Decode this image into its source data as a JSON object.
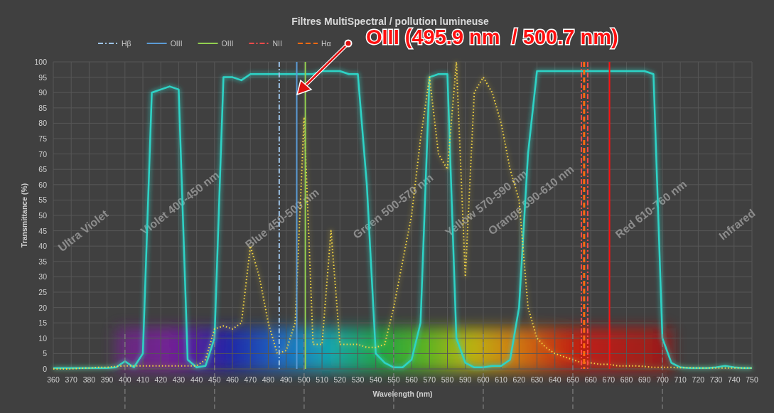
{
  "chart": {
    "chart_data": {
      "type": "line",
      "title": "Filtres MultiSpectral / pollution lumineuse",
      "xlabel": "Wavelength (nm)",
      "ylabel": "Transmittance (%)",
      "x": [
        360,
        365,
        370,
        375,
        380,
        385,
        390,
        395,
        400,
        405,
        410,
        415,
        420,
        425,
        430,
        435,
        440,
        445,
        450,
        455,
        460,
        465,
        470,
        475,
        480,
        485,
        490,
        495,
        500,
        505,
        510,
        515,
        520,
        525,
        530,
        535,
        540,
        545,
        550,
        555,
        560,
        565,
        570,
        575,
        580,
        585,
        590,
        595,
        600,
        605,
        610,
        615,
        620,
        625,
        630,
        635,
        640,
        645,
        650,
        655,
        660,
        665,
        670,
        675,
        680,
        685,
        690,
        695,
        700,
        705,
        710,
        715,
        720,
        725,
        730,
        735,
        740,
        745,
        750
      ],
      "series": [
        {
          "color": "#2ed3c6",
          "line_style": "solid",
          "values": [
            0.3,
            0.3,
            0.3,
            0.3,
            0.3,
            0.3,
            0.3,
            0.5,
            2.5,
            0.5,
            5,
            90,
            91,
            92,
            91,
            3,
            0.5,
            1,
            10,
            95,
            95,
            94,
            96,
            96,
            96,
            96,
            96,
            96,
            96,
            96,
            97,
            97,
            97,
            96,
            96,
            60,
            5,
            2,
            0.5,
            0.5,
            3,
            15,
            95,
            96,
            96,
            10,
            2,
            0.5,
            0.5,
            1,
            1,
            3,
            20,
            70,
            97,
            97,
            97,
            97,
            97,
            97,
            97,
            97,
            97,
            97,
            97,
            97,
            97,
            96,
            10,
            2,
            0.5,
            0.3,
            0.3,
            0.3,
            0.5,
            1,
            0.5,
            0.3,
            0.3
          ]
        },
        {
          "color": "#f5d742",
          "line_style": "dotted",
          "values": [
            0,
            0,
            0,
            0.2,
            0.3,
            0.5,
            0.5,
            0.8,
            1,
            1,
            1,
            1,
            1,
            1,
            1,
            1,
            1,
            3,
            13,
            14,
            13,
            15,
            40,
            30,
            15,
            5,
            6,
            15,
            82,
            8,
            8,
            45,
            8,
            8,
            8,
            7,
            7,
            8,
            20,
            35,
            50,
            75,
            95,
            70,
            65,
            100,
            30,
            90,
            95,
            90,
            80,
            65,
            55,
            20,
            10,
            7,
            5,
            4,
            3,
            2,
            2,
            1.5,
            1.5,
            1,
            1,
            1,
            0.8,
            0.5,
            0.5,
            0.5,
            0.4,
            0.4,
            0.3,
            0.3,
            0.3,
            0.3,
            0.3,
            0.3,
            0.3
          ]
        }
      ],
      "xlim": [
        360,
        750
      ],
      "ylim": [
        0,
        100
      ],
      "xticks": [
        360,
        370,
        380,
        390,
        400,
        410,
        420,
        430,
        440,
        450,
        460,
        470,
        480,
        490,
        500,
        510,
        520,
        530,
        540,
        550,
        560,
        570,
        580,
        590,
        600,
        610,
        620,
        630,
        640,
        650,
        660,
        670,
        680,
        690,
        700,
        710,
        720,
        730,
        740,
        750
      ],
      "yticks": [
        0,
        5,
        10,
        15,
        20,
        25,
        30,
        35,
        40,
        45,
        50,
        55,
        60,
        65,
        70,
        75,
        80,
        85,
        90,
        95,
        100
      ],
      "grid": true,
      "legend": "top",
      "ref_lines": [
        {
          "axis": "x",
          "value": 486.1,
          "label": "Hβ",
          "color": "#9dc3e6",
          "line_style": "dashdot"
        },
        {
          "axis": "x",
          "value": 495.9,
          "label": "OIII",
          "color": "#5b9bd5",
          "line_style": "solid"
        },
        {
          "axis": "x",
          "value": 500.7,
          "label": "OIII",
          "color": "#92d050",
          "line_style": "solid"
        },
        {
          "axis": "x",
          "value": 654.8,
          "label": "NII",
          "color": "#ff4b4b",
          "line_style": "dashdot"
        },
        {
          "axis": "x",
          "value": 658.3,
          "color": "#ff4b4b",
          "line_style": "dashdot"
        },
        {
          "axis": "x",
          "value": 656.3,
          "label": "Hα",
          "color": "#ff6a10",
          "line_style": "dashed"
        },
        {
          "axis": "x",
          "value": 670.5,
          "color": "#ff1010",
          "line_style": "solid"
        },
        {
          "axis": "x",
          "value": 400,
          "color": "#8a8a8a",
          "line_style": "dashed"
        },
        {
          "axis": "x",
          "value": 450,
          "color": "#8a8a8a",
          "line_style": "dashed"
        },
        {
          "axis": "x",
          "value": 500,
          "color": "#8a8a8a",
          "line_style": "dashed"
        },
        {
          "axis": "x",
          "value": 550,
          "color": "#8a8a8a",
          "line_style": "dashed"
        },
        {
          "axis": "x",
          "value": 600,
          "color": "#8a8a8a",
          "line_style": "dashed"
        },
        {
          "axis": "x",
          "value": 650,
          "color": "#8a8a8a",
          "line_style": "dashed"
        },
        {
          "axis": "x",
          "value": 700,
          "color": "#8a8a8a",
          "line_style": "dashed"
        }
      ],
      "annotations": [
        "Ultra Violet",
        "Violet 400-450 nm",
        "Blue 450-500 nm",
        "Green 500-570 nm",
        "Yellow 570-590 nm",
        "Orange 590-610 nm",
        "Red 610-760 nm",
        "Infrared"
      ]
    }
  },
  "callout": {
    "text": "OIII (495.9 nm  / 500.7 nm)"
  }
}
